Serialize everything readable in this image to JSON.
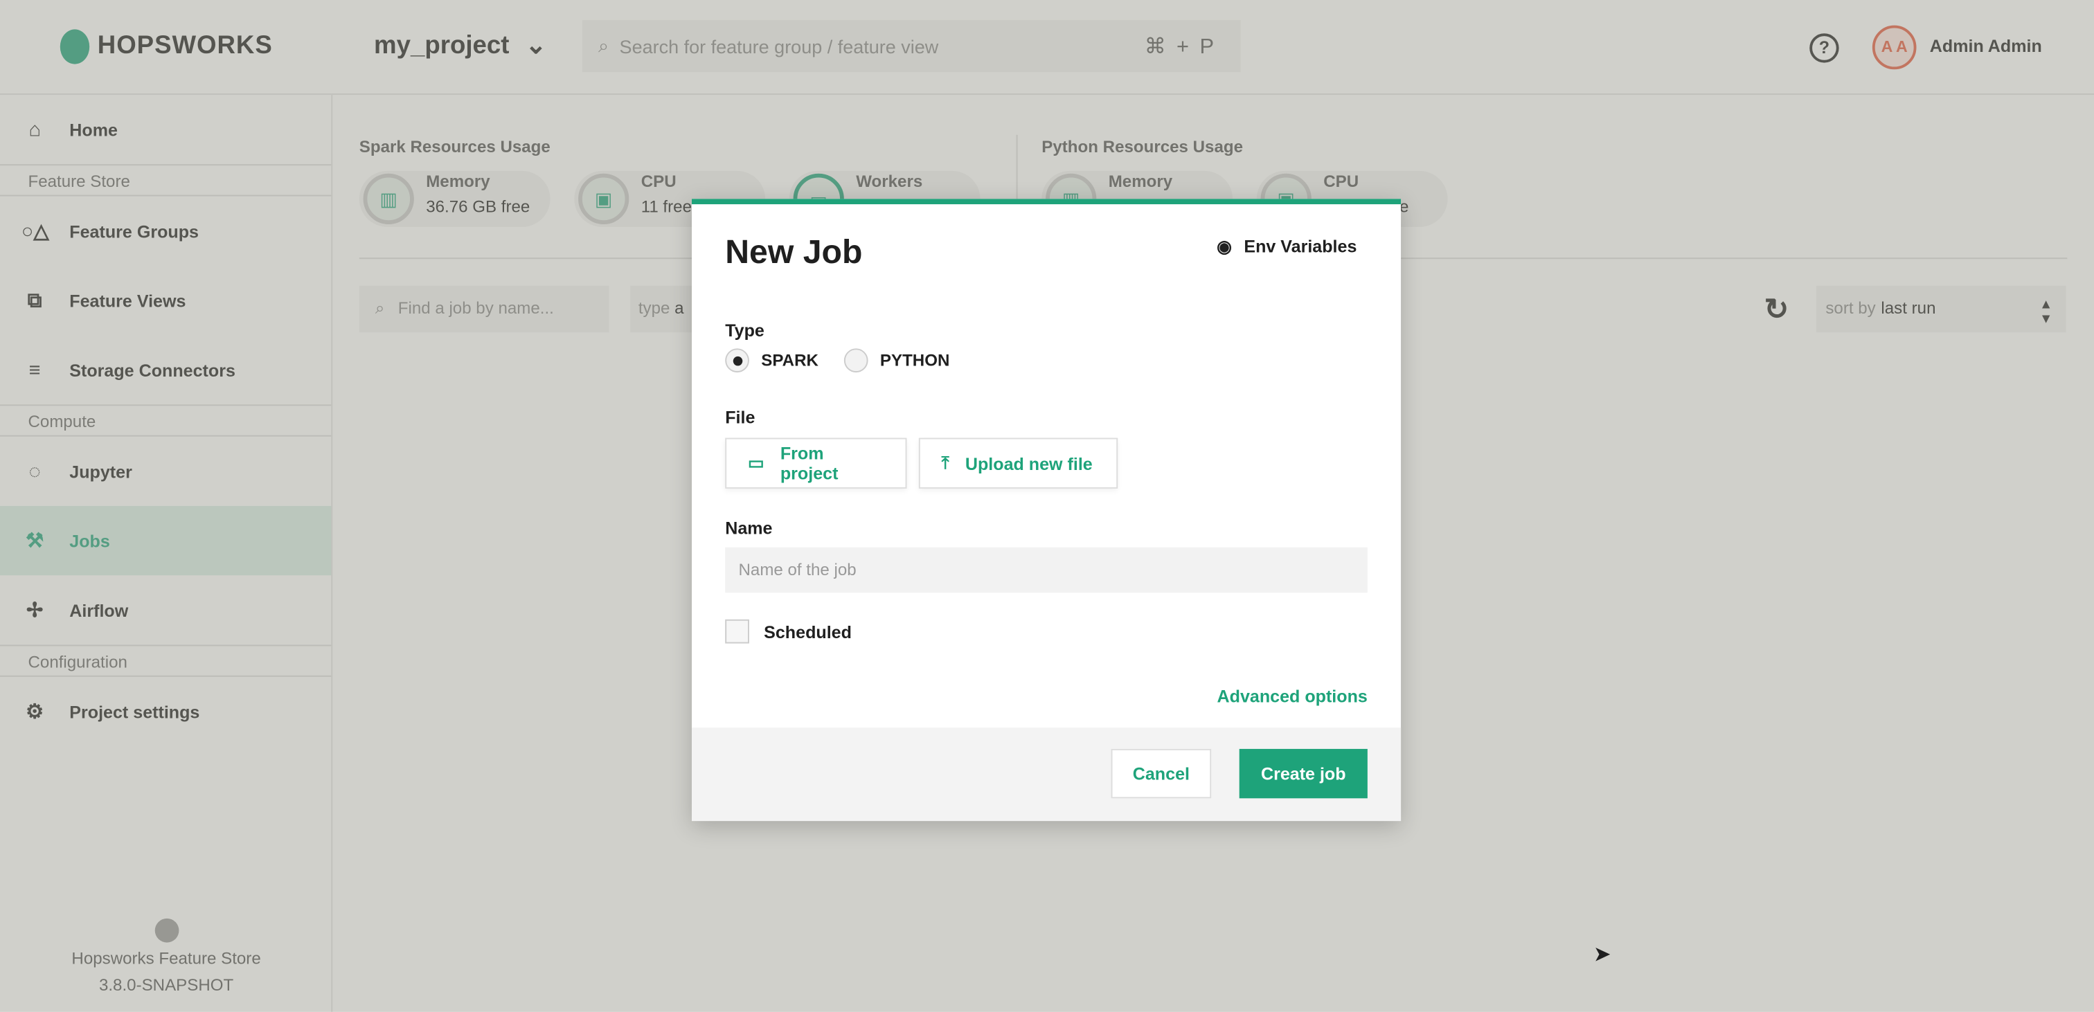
{
  "header": {
    "brand": "HOPSWORKS",
    "project": "my_project",
    "search_placeholder": "Search for feature group / feature view",
    "shortcut": "⌘+P",
    "help": "?",
    "avatar_initials": "A A",
    "user_name": "Admin Admin"
  },
  "sidebar": {
    "items": [
      {
        "label": "Home",
        "icon": "⌂"
      },
      {
        "section": "Feature Store"
      },
      {
        "label": "Feature Groups",
        "icon": "○△"
      },
      {
        "label": "Feature Views",
        "icon": "⧉"
      },
      {
        "label": "Storage Connectors",
        "icon": "≡"
      },
      {
        "section": "Compute"
      },
      {
        "label": "Jupyter",
        "icon": "◌"
      },
      {
        "label": "Jobs",
        "icon": "⚒"
      },
      {
        "label": "Airflow",
        "icon": "✢"
      },
      {
        "section": "Configuration"
      },
      {
        "label": "Project settings",
        "icon": "⚙"
      }
    ],
    "footer_title": "Hopsworks Feature Store",
    "footer_version": "3.8.0-SNAPSHOT"
  },
  "resources": {
    "spark_title": "Spark Resources Usage",
    "python_title": "Python Resources Usage",
    "spark": [
      {
        "label": "Memory",
        "value": "36.76 GB free"
      },
      {
        "label": "CPU",
        "value": "11 free"
      },
      {
        "label": "Workers",
        "value": ""
      }
    ],
    "python": [
      {
        "label": "Memory",
        "value": ""
      },
      {
        "label": "CPU",
        "value": "ee"
      }
    ]
  },
  "filters": {
    "search_placeholder": "Find a job by name...",
    "type_label": "type",
    "type_value": "a",
    "sort_label": "sort by",
    "sort_value": "last run"
  },
  "modal": {
    "title": "New Job",
    "env_variables": "Env Variables",
    "type_label": "Type",
    "types": [
      "SPARK",
      "PYTHON"
    ],
    "selected_type": "SPARK",
    "file_label": "File",
    "from_project": "From project",
    "upload_file": "Upload new file",
    "name_label": "Name",
    "name_placeholder": "Name of the job",
    "name_value": "",
    "scheduled_label": "Scheduled",
    "scheduled": false,
    "advanced": "Advanced options",
    "cancel": "Cancel",
    "create": "Create job"
  },
  "colors": {
    "accent": "#1ea37a",
    "avatar": "#e55a3c"
  }
}
